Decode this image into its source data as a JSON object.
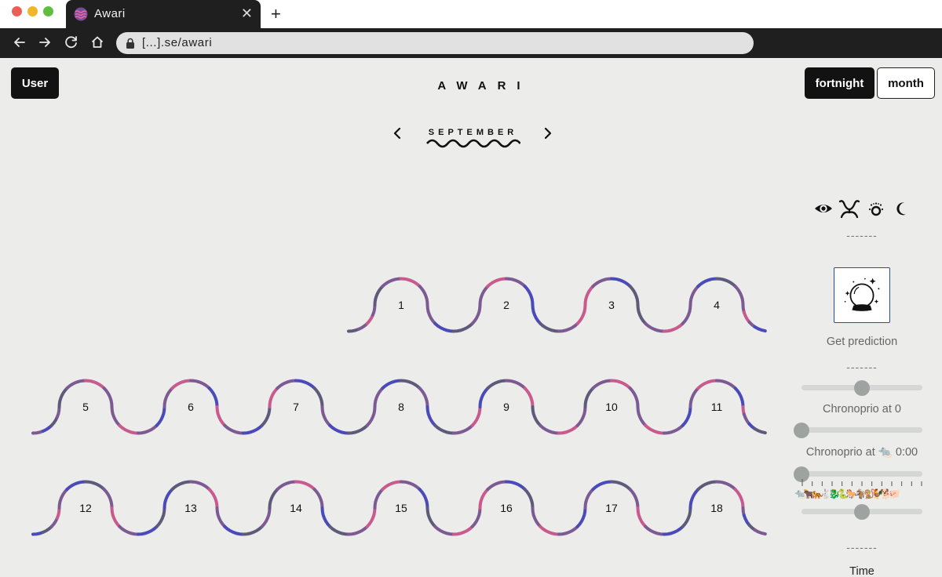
{
  "browser": {
    "tab_title": "Awari",
    "url": "[...].se/awari",
    "new_tab_icon": "plus-icon",
    "close_icon": "close-icon"
  },
  "header": {
    "user_button": "User",
    "logo": "AWARI",
    "view_options": [
      "fortnight",
      "month"
    ],
    "active_view": "fortnight"
  },
  "calendar": {
    "month": "SEPTEMBER",
    "rows": [
      [
        "1",
        "2",
        "3",
        "4"
      ],
      [
        "5",
        "6",
        "7",
        "8",
        "9",
        "10",
        "11"
      ],
      [
        "12",
        "13",
        "14",
        "15",
        "16",
        "17",
        "18"
      ]
    ],
    "colors": {
      "pink": "#c85a8e",
      "blue": "#4a4ab8",
      "purple": "#7c5a92",
      "slate": "#5d5a7a"
    }
  },
  "panel": {
    "icons": [
      "eye-icon",
      "cancer-sign-icon",
      "sun-icon",
      "moon-icon"
    ],
    "divider": "-------",
    "prediction_icon": "crystal-ball-icon",
    "get_prediction": "Get prediction",
    "chronoprio_label": "Chronoprio at 0",
    "chronoprio_time_label": "Chronoprio at 🐀 0:00",
    "animals": "🐀🐂🐅🐇🐉🐍🐎🐐🐒🐓🐕🐖",
    "time_label": "Time",
    "sliders": [
      {
        "name": "prediction-slider",
        "value": 0.5
      },
      {
        "name": "chronoprio-slider",
        "value": 0
      },
      {
        "name": "chronoprio-time-slider",
        "value": 0
      },
      {
        "name": "time-slider",
        "value": 0.5
      }
    ]
  }
}
